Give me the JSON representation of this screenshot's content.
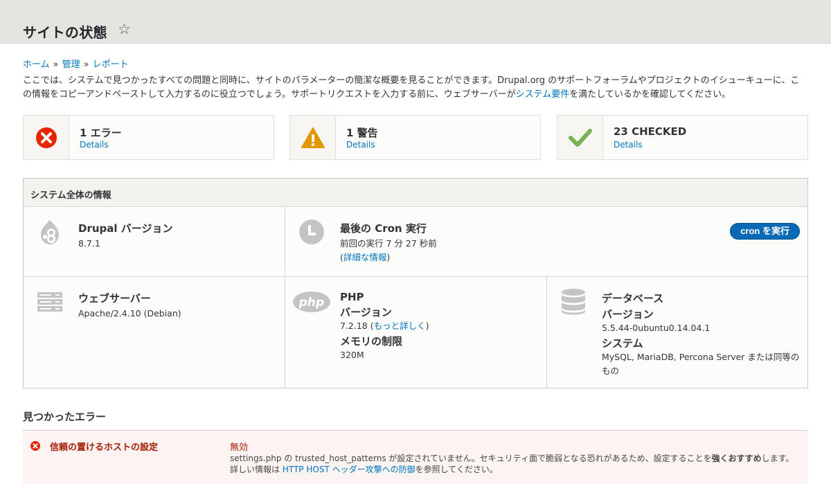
{
  "page": {
    "title": "サイトの状態"
  },
  "breadcrumb": {
    "home": "ホーム",
    "sep": "»",
    "admin": "管理",
    "reports": "レポート"
  },
  "intro": {
    "text_1": "ここでは、システムで見つかったすべての問題と同時に、サイトのパラメーターの簡潔な概要を見ることができます。Drupal.org のサポートフォーラムやプロジェクトのイシューキューに、この情報をコピーアンドペーストして入力するのに役立つでしょう。サポートリクエストを入力する前に、ウェブサーバーが",
    "link": "システム要件",
    "text_2": "を満たしているかを確認してください。"
  },
  "counters": [
    {
      "title": "1 エラー",
      "details": "Details",
      "icon": "error-icon",
      "color": "#e62600"
    },
    {
      "title": "1 警告",
      "details": "Details",
      "icon": "warning-icon",
      "color": "#e29700"
    },
    {
      "title": "23 CHECKED",
      "details": "Details",
      "icon": "checkmark-icon",
      "color": "#73b355"
    }
  ],
  "sysinfo": {
    "heading": "システム全体の情報",
    "drupal": {
      "title": "Drupal バージョン",
      "value": "8.7.1",
      "icon": "drupal-icon"
    },
    "cron": {
      "title": "最後の Cron 実行",
      "value": "前回の実行 7 分 27 秒前",
      "paren_open": "(",
      "link": "詳細な情報",
      "paren_close": ")",
      "button": "cron を実行",
      "icon": "clock-icon"
    },
    "webserver": {
      "title": "ウェブサーバー",
      "value": "Apache/2.4.10 (Debian)",
      "icon": "server-icon"
    },
    "php": {
      "title": "PHP",
      "version_label": "バージョン",
      "version": "7.2.18",
      "paren_open": " (",
      "more_link": "もっと詳しく",
      "paren_close": ")",
      "memory_label": "メモリの制限",
      "memory": "320M",
      "icon": "php-icon"
    },
    "database": {
      "title": "データベース",
      "version_label": "バージョン",
      "version": "5.5.44-0ubuntu0.14.04.1",
      "system_label": "システム",
      "system": "MySQL, MariaDB, Percona Server または同等のもの",
      "icon": "database-icon"
    }
  },
  "errors": {
    "heading": "見つかったエラー",
    "items": [
      {
        "title": "信頼の置けるホストの設定",
        "status": "無効",
        "desc_1": "settings.php の trusted_host_patterns が設定されていません。セキュリティ面で脆弱となる恐れがあるため、設定することを",
        "desc_bold": "強くおすすめ",
        "desc_2": "します。詳しい情報は ",
        "desc_link": "HTTP HOST ヘッダー攻撃への防御",
        "desc_3": "を参照してください。"
      }
    ]
  }
}
